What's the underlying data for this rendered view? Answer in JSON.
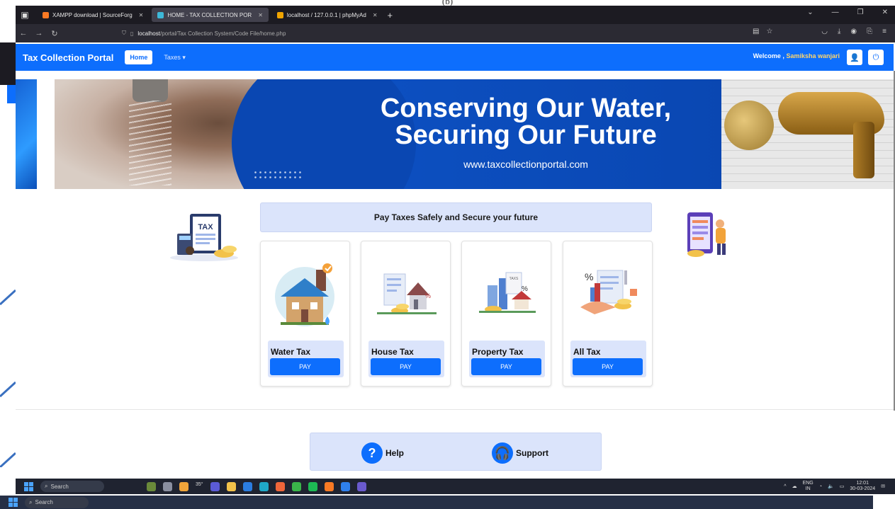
{
  "figure_label": "(b)",
  "browser": {
    "tabs": [
      {
        "label": "XAMPP download | SourceForg",
        "favicon_color": "#fb7a24",
        "active": false
      },
      {
        "label": "HOME - TAX COLLECTION POR",
        "favicon_color": "#3db8d8",
        "active": true
      },
      {
        "label": "localhost / 127.0.0.1 | phpMyAd",
        "favicon_color": "#f0a400",
        "active": false
      }
    ],
    "new_tab": "+",
    "url_prefix": "localhost",
    "url_path": "/portal/Tax Collection System/Code File/home.php"
  },
  "navbar": {
    "brand": "Tax Collection Portal",
    "home": "Home",
    "taxes": "Taxes ▾",
    "welcome_prefix": "Welcome ,",
    "username": "Samiksha wanjari",
    "brand_color": "#0d6efd"
  },
  "banner": {
    "headline_line1": "Conserving Our Water,",
    "headline_line2": "Securing Our Future",
    "website": "www.taxcollectionportal.com"
  },
  "tax_illustration_label": "TAX",
  "tagline": "Pay Taxes Safely and Secure your future",
  "cards": [
    {
      "title": "Water Tax",
      "button": "PAY"
    },
    {
      "title": "House Tax",
      "button": "PAY"
    },
    {
      "title": "Property Tax",
      "button": "PAY"
    },
    {
      "title": "All Tax",
      "button": "PAY"
    }
  ],
  "footer": {
    "help": "Help",
    "support": "Support"
  },
  "taskbar": {
    "search": "Search",
    "weather": "35°",
    "lang_line1": "ENG",
    "lang_line2": "IN",
    "time": "12:01",
    "date": "30-03-2024"
  }
}
